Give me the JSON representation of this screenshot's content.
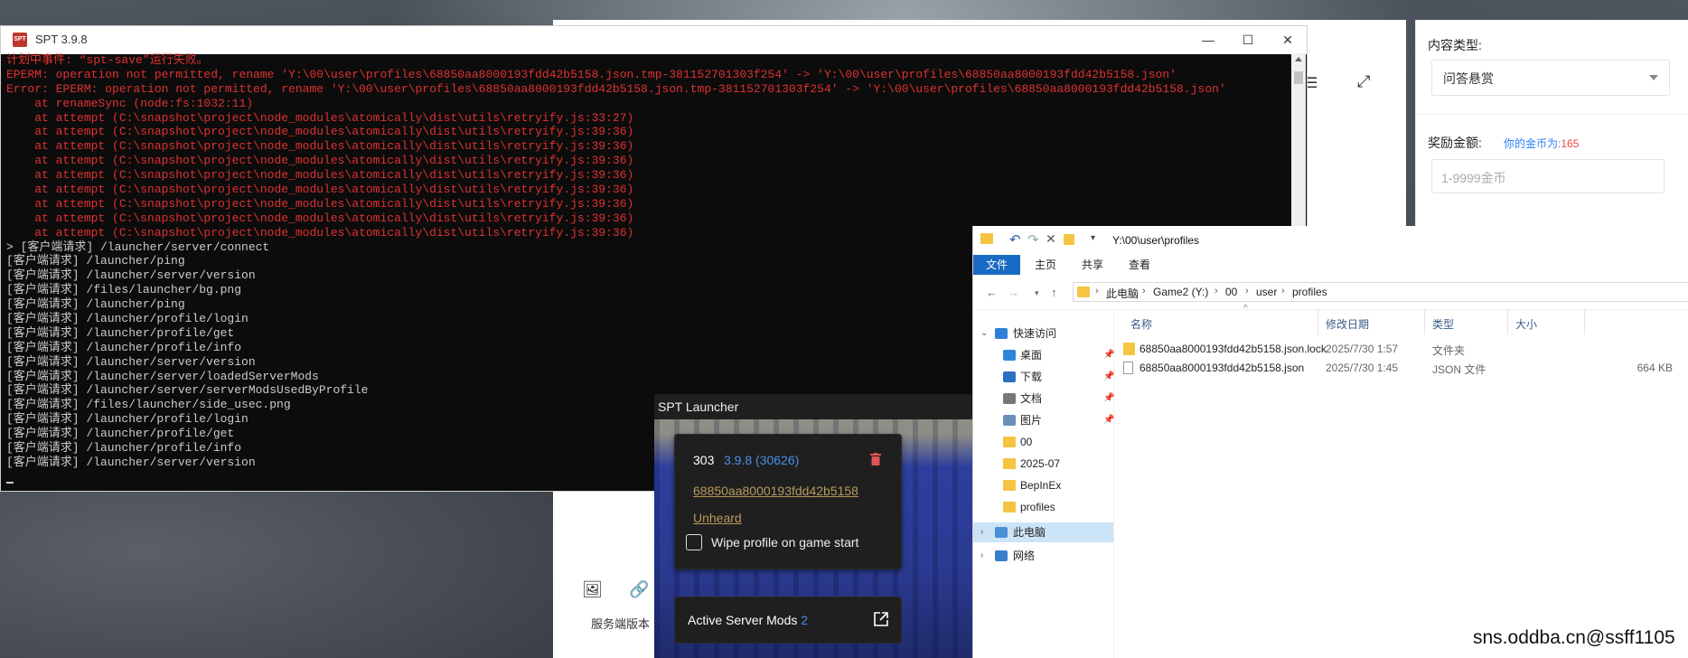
{
  "web": {
    "content_type_label": "内容类型:",
    "content_type_value": "问答悬赏",
    "reward_label": "奖励金额:",
    "coin_note_prefix": "你的金币为:",
    "coin_note_value": "165",
    "reward_placeholder": "1-9999金币",
    "server_version_partial": "服务端版本"
  },
  "console": {
    "title": "SPT 3.9.8",
    "app_icon_text": "SPT",
    "lines": [
      {
        "text": "计划中事件: “spt-save”运行失败。",
        "kind": "err"
      },
      {
        "text": "EPERM: operation not permitted, rename 'Y:\\00\\user\\profiles\\68850aa8000193fdd42b5158.json.tmp-381152701303f254' -> 'Y:\\00\\user\\profiles\\68850aa8000193fdd42b5158.json'",
        "kind": "err"
      },
      {
        "text": "Error: EPERM: operation not permitted, rename 'Y:\\00\\user\\profiles\\68850aa8000193fdd42b5158.json.tmp-381152701303f254' -> 'Y:\\00\\user\\profiles\\68850aa8000193fdd42b5158.json'",
        "kind": "err"
      },
      {
        "text": "    at renameSync (node:fs:1032:11)",
        "kind": "err"
      },
      {
        "text": "    at attempt (C:\\snapshot\\project\\node_modules\\atomically\\dist\\utils\\retryify.js:33:27)",
        "kind": "err"
      },
      {
        "text": "    at attempt (C:\\snapshot\\project\\node_modules\\atomically\\dist\\utils\\retryify.js:39:36)",
        "kind": "err"
      },
      {
        "text": "    at attempt (C:\\snapshot\\project\\node_modules\\atomically\\dist\\utils\\retryify.js:39:36)",
        "kind": "err"
      },
      {
        "text": "    at attempt (C:\\snapshot\\project\\node_modules\\atomically\\dist\\utils\\retryify.js:39:36)",
        "kind": "err"
      },
      {
        "text": "    at attempt (C:\\snapshot\\project\\node_modules\\atomically\\dist\\utils\\retryify.js:39:36)",
        "kind": "err"
      },
      {
        "text": "    at attempt (C:\\snapshot\\project\\node_modules\\atomically\\dist\\utils\\retryify.js:39:36)",
        "kind": "err"
      },
      {
        "text": "    at attempt (C:\\snapshot\\project\\node_modules\\atomically\\dist\\utils\\retryify.js:39:36)",
        "kind": "err"
      },
      {
        "text": "    at attempt (C:\\snapshot\\project\\node_modules\\atomically\\dist\\utils\\retryify.js:39:36)",
        "kind": "err"
      },
      {
        "text": "    at attempt (C:\\snapshot\\project\\node_modules\\atomically\\dist\\utils\\retryify.js:39:36)",
        "kind": "err"
      },
      {
        "text": "> [客户端请求] /launcher/server/connect",
        "kind": "info"
      },
      {
        "text": "[客户端请求] /launcher/ping",
        "kind": "info"
      },
      {
        "text": "[客户端请求] /launcher/server/version",
        "kind": "info"
      },
      {
        "text": "[客户端请求] /files/launcher/bg.png",
        "kind": "info"
      },
      {
        "text": "[客户端请求] /launcher/ping",
        "kind": "info"
      },
      {
        "text": "[客户端请求] /launcher/profile/login",
        "kind": "info"
      },
      {
        "text": "[客户端请求] /launcher/profile/get",
        "kind": "info"
      },
      {
        "text": "[客户端请求] /launcher/profile/info",
        "kind": "info"
      },
      {
        "text": "[客户端请求] /launcher/server/version",
        "kind": "info"
      },
      {
        "text": "[客户端请求] /launcher/server/loadedServerMods",
        "kind": "info"
      },
      {
        "text": "[客户端请求] /launcher/server/serverModsUsedByProfile",
        "kind": "info"
      },
      {
        "text": "[客户端请求] /files/launcher/side_usec.png",
        "kind": "info"
      },
      {
        "text": "[客户端请求] /launcher/profile/login",
        "kind": "info"
      },
      {
        "text": "[客户端请求] /launcher/profile/get",
        "kind": "info"
      },
      {
        "text": "[客户端请求] /launcher/profile/info",
        "kind": "info"
      },
      {
        "text": "[客户端请求] /launcher/server/version",
        "kind": "info"
      }
    ]
  },
  "launcher": {
    "title": "SPT Launcher",
    "profile_number": "303",
    "version": "3.9.8 (30626)",
    "profile_id": "68850aa8000193fdd42b5158",
    "profile_name": "Unheard",
    "wipe_label": "Wipe profile on game start",
    "mods_label": "Active Server Mods",
    "mods_count": "2"
  },
  "explorer": {
    "title_path": "Y:\\00\\user\\profiles",
    "tabs": [
      "文件",
      "主页",
      "共享",
      "查看"
    ],
    "breadcrumbs": [
      "此电脑",
      "Game2 (Y:)",
      "00",
      "user",
      "profiles"
    ],
    "quick_access": "快速访问",
    "tree": [
      {
        "label": "桌面",
        "icon": "desktop-icon",
        "pinned": true
      },
      {
        "label": "下载",
        "icon": "download-icon",
        "pinned": true
      },
      {
        "label": "文档",
        "icon": "document-icon",
        "pinned": true
      },
      {
        "label": "图片",
        "icon": "picture-icon",
        "pinned": true
      },
      {
        "label": "00",
        "icon": "folder-icon",
        "pinned": false
      },
      {
        "label": "2025-07",
        "icon": "folder-icon",
        "pinned": false
      },
      {
        "label": "BepInEx",
        "icon": "folder-icon",
        "pinned": false
      },
      {
        "label": "profiles",
        "icon": "folder-icon",
        "pinned": false
      }
    ],
    "this_pc": "此电脑",
    "network": "网络",
    "columns": [
      "名称",
      "修改日期",
      "类型",
      "大小"
    ],
    "files": [
      {
        "name": "68850aa8000193fdd42b5158.json.lock",
        "date": "2025/7/30 1:57",
        "type": "文件夹",
        "size": "",
        "icon": "folder-icon"
      },
      {
        "name": "68850aa8000193fdd42b5158.json",
        "date": "2025/7/30 1:45",
        "type": "JSON 文件",
        "size": "664 KB",
        "icon": "file-icon"
      }
    ]
  },
  "watermark": "sns.oddba.cn@ssff1105",
  "colors": {
    "console_error": "#e03131",
    "console_text": "#cccccc",
    "launcher_accent": "#4a8fe8",
    "link_gold": "#b89a5a",
    "explorer_file_tab": "#1a6bc4",
    "coin_red": "#e44"
  }
}
